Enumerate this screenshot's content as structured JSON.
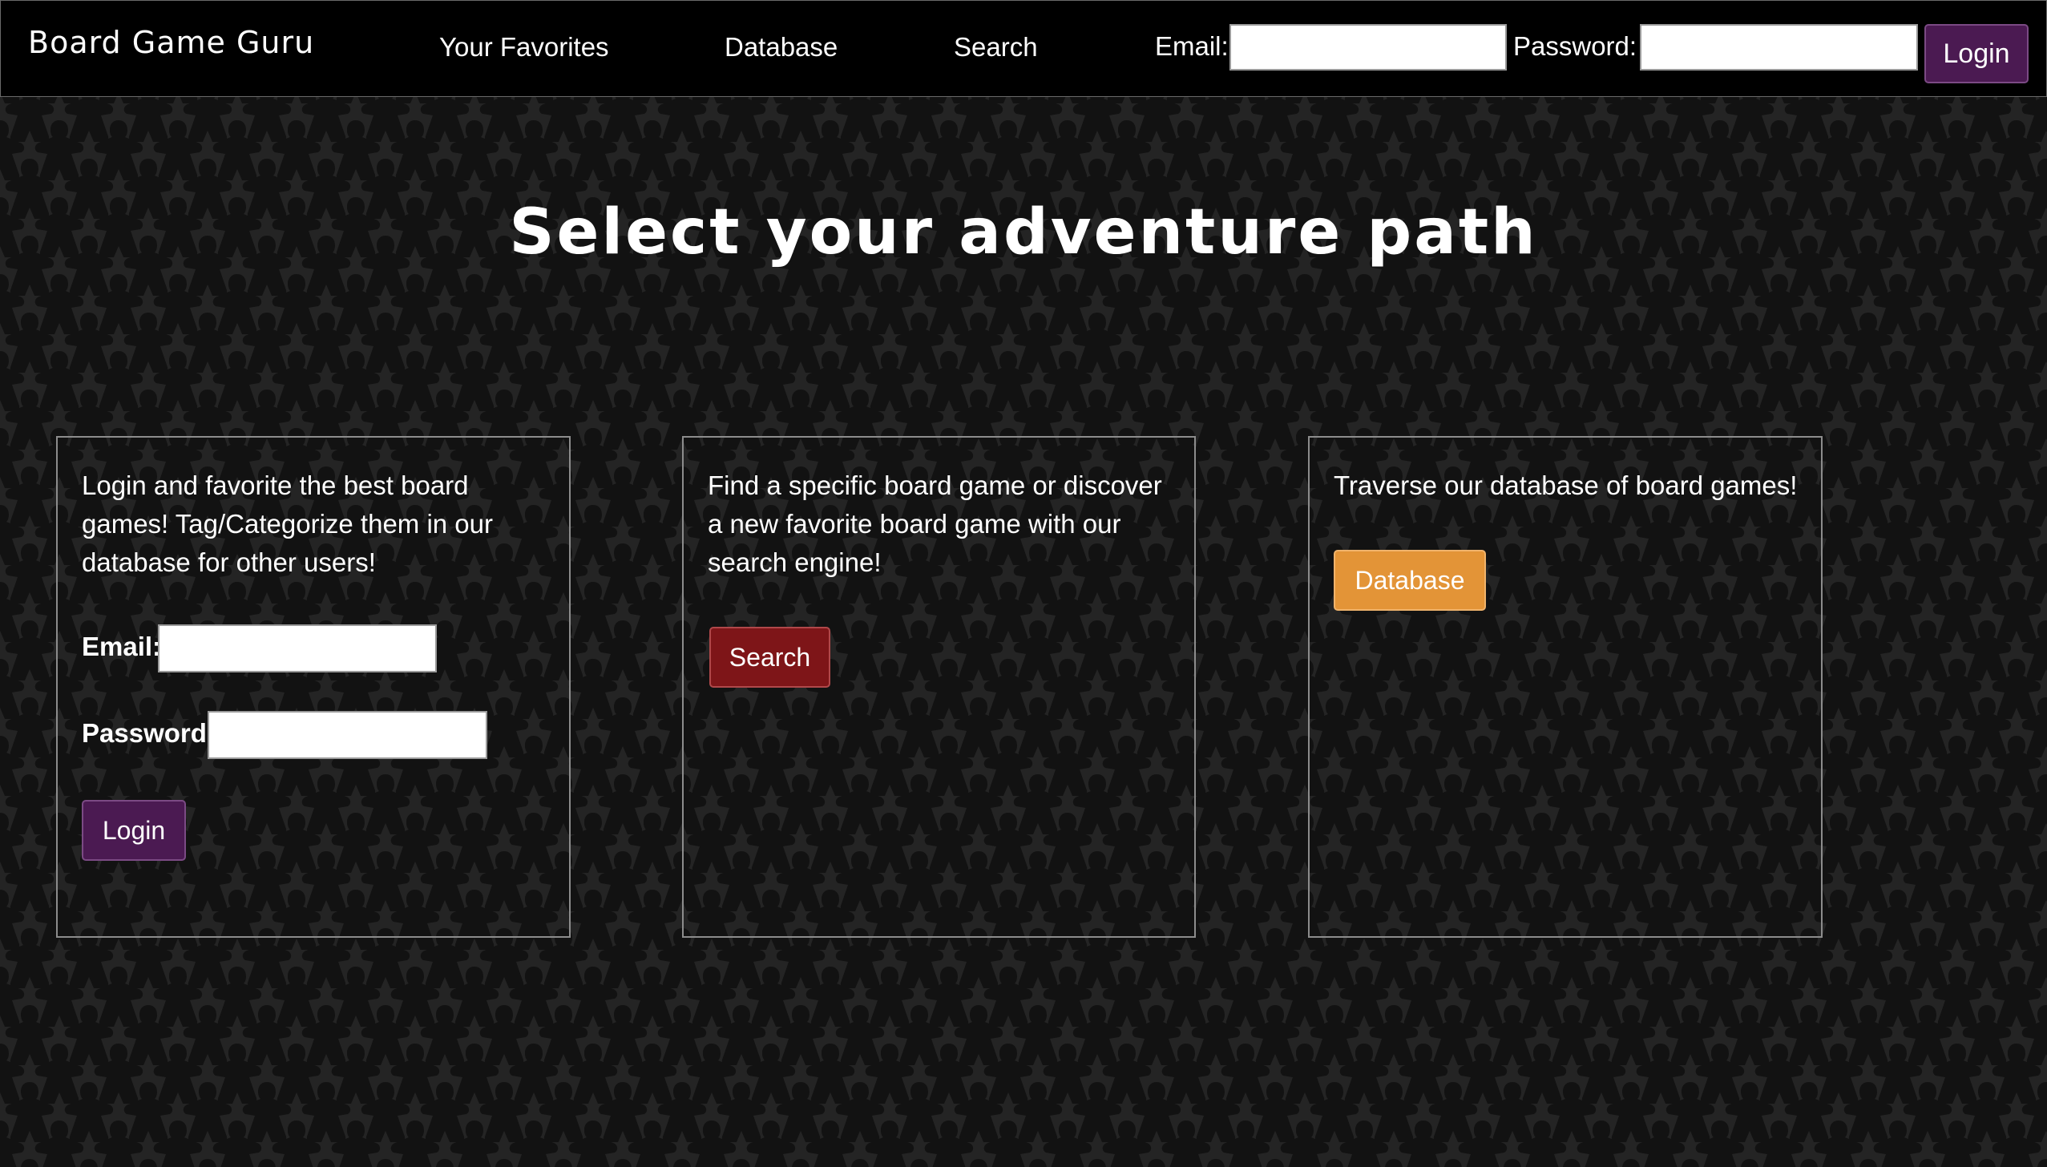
{
  "navbar": {
    "brand": "Board Game Guru",
    "links": [
      {
        "label": "Your Favorites"
      },
      {
        "label": "Database"
      },
      {
        "label": "Search"
      }
    ],
    "email_label": "Email:",
    "password_label": "Password:",
    "email_value": "",
    "password_value": "",
    "login_label": "Login"
  },
  "hero": {
    "title": "Select your adventure path"
  },
  "cards": {
    "login": {
      "text": "Login and favorite the best board games! Tag/Categorize them in our database for other users!",
      "email_label": "Email:",
      "password_label": "Password:",
      "email_value": "",
      "password_value": "",
      "button_label": "Login"
    },
    "search": {
      "text": "Find a specific board game or discover a new favorite board game with our search engine!",
      "button_label": "Search"
    },
    "database": {
      "text": "Traverse our database of board games!",
      "button_label": "Database"
    }
  },
  "background": {
    "pattern_icon": "meeple-icon",
    "color": "#242424",
    "pattern_color": "#121212"
  },
  "colors": {
    "primary_purple": "#4b1a52",
    "search_red": "#7e1518",
    "database_orange": "#e39437"
  }
}
